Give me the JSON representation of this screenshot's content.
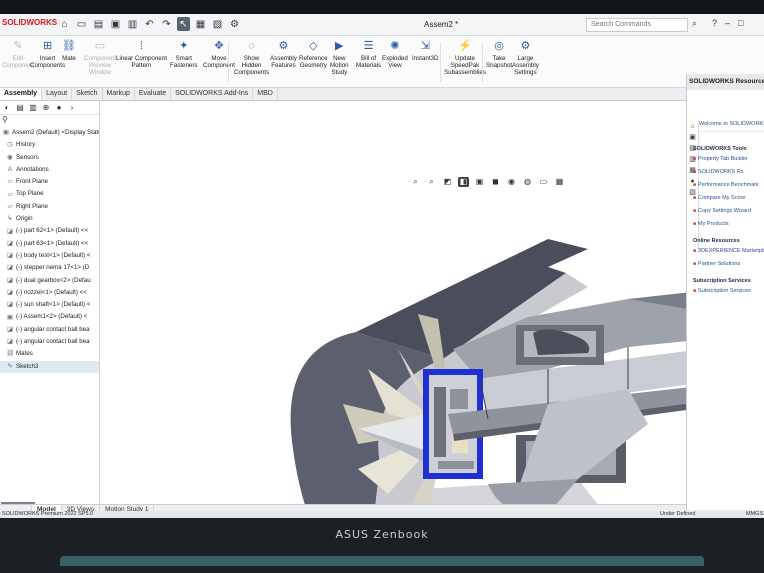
{
  "app": {
    "logo_text": "SOLIDWORKS",
    "document_title": "Assem2 *",
    "search_placeholder": "Search Commands"
  },
  "quick_access": [
    "home",
    "new",
    "open",
    "save",
    "print",
    "undo",
    "redo",
    "select",
    "rebuild",
    "file-properties",
    "options"
  ],
  "ribbon": [
    {
      "label": "Edit\nComponent",
      "dim": true
    },
    {
      "label": "Insert\nComponents",
      "dim": false
    },
    {
      "label": "Mate",
      "dim": false
    },
    {
      "label": "Component\nPreview\nWindow",
      "dim": true
    },
    {
      "label": "Linear Component\nPattern",
      "dim": false
    },
    {
      "label": "Smart\nFasteners",
      "dim": false
    },
    {
      "label": "Move\nComponent",
      "dim": false
    },
    {
      "label": "Show\nHidden\nComponents",
      "dim": false
    },
    {
      "label": "Assembly\nFeatures",
      "dim": false
    },
    {
      "label": "Reference\nGeometry",
      "dim": false
    },
    {
      "label": "New\nMotion\nStudy",
      "dim": false
    },
    {
      "label": "Bill of\nMaterials",
      "dim": false
    },
    {
      "label": "Exploded\nView",
      "dim": false
    },
    {
      "label": "Instant3D",
      "dim": false
    },
    {
      "label": "Update\nSpeedPak\nSubassemblies",
      "dim": false
    },
    {
      "label": "Take\nSnapshot",
      "dim": false
    },
    {
      "label": "Large\nAssembly\nSettings",
      "dim": false
    }
  ],
  "tabs": [
    "Assembly",
    "Layout",
    "Sketch",
    "Markup",
    "Evaluate",
    "SOLIDWORKS Add-Ins",
    "MBD"
  ],
  "active_tab": "Assembly",
  "feature_tree": {
    "items": [
      {
        "label": "Assem2 (Default) <Display State",
        "level": "root",
        "icon": "assembly-icon"
      },
      {
        "label": "History",
        "level": "child",
        "icon": "history-icon"
      },
      {
        "label": "Sensors",
        "level": "child",
        "icon": "sensor-icon"
      },
      {
        "label": "Annotations",
        "level": "child",
        "icon": "annotation-icon"
      },
      {
        "label": "Front Plane",
        "level": "child",
        "icon": "plane-icon"
      },
      {
        "label": "Top Plane",
        "level": "child",
        "icon": "plane-icon"
      },
      {
        "label": "Right Plane",
        "level": "child",
        "icon": "plane-icon"
      },
      {
        "label": "Origin",
        "level": "child",
        "icon": "origin-icon"
      },
      {
        "label": "(-) part 62<1> (Default) <<",
        "level": "child",
        "icon": "part-icon"
      },
      {
        "label": "(-) part 63<1> (Default) <<",
        "level": "child",
        "icon": "part-icon"
      },
      {
        "label": "(-) body test<1> (Default) <",
        "level": "child",
        "icon": "part-icon"
      },
      {
        "label": "(-) stepper nema 17<1> (D",
        "level": "child",
        "icon": "part-icon"
      },
      {
        "label": "(-) dual gearbox<2> (Defau",
        "level": "child",
        "icon": "part-icon"
      },
      {
        "label": "(-) nozzel<1> (Default) <<",
        "level": "child",
        "icon": "part-icon"
      },
      {
        "label": "(-) sun shaft<1> (Default) <",
        "level": "child",
        "icon": "part-icon"
      },
      {
        "label": "(-) Assem1<2> (Default) <",
        "level": "child",
        "icon": "subassembly-icon"
      },
      {
        "label": "(-) angular contact ball bea",
        "level": "child",
        "icon": "part-icon"
      },
      {
        "label": "(-) angular contact ball bea",
        "level": "child",
        "icon": "part-icon"
      },
      {
        "label": "Mates",
        "level": "child",
        "icon": "mates-icon"
      },
      {
        "label": "Sketch3",
        "level": "child",
        "icon": "sketch-icon"
      }
    ]
  },
  "task_pane": {
    "title": "SOLIDWORKS Resources",
    "welcome": "Welcome to SOLIDWORKS",
    "sections": [
      {
        "title": "SOLIDWORKS Tools",
        "items": [
          "Property Tab Builder",
          "SOLIDWORKS Rx",
          "Performance Benchmark",
          "Compare My Score",
          "Copy Settings Wizard",
          "My Products"
        ]
      },
      {
        "title": "Online Resources",
        "items": [
          "3DEXPERIENCE Marketplace",
          "Partner Solutions"
        ]
      },
      {
        "title": "Subscription Services",
        "items": [
          "Subscription Services"
        ]
      }
    ]
  },
  "bottom_tabs": [
    "Model",
    "3D Views",
    "Motion Study 1"
  ],
  "active_bottom_tab": "Model",
  "status_bar": {
    "left": "SOLIDWORKS Premium 2022 SP5.0",
    "right": "Under Defined",
    "units": "MMGS"
  },
  "laptop": {
    "brand": "ASUS Zenbook"
  },
  "colors": {
    "accent_blue": "#2b5ea7",
    "logo_red": "#d71920",
    "model_gray": "#b9bcc3",
    "model_dark": "#3e4250",
    "section_blue": "#1f2fd0"
  }
}
